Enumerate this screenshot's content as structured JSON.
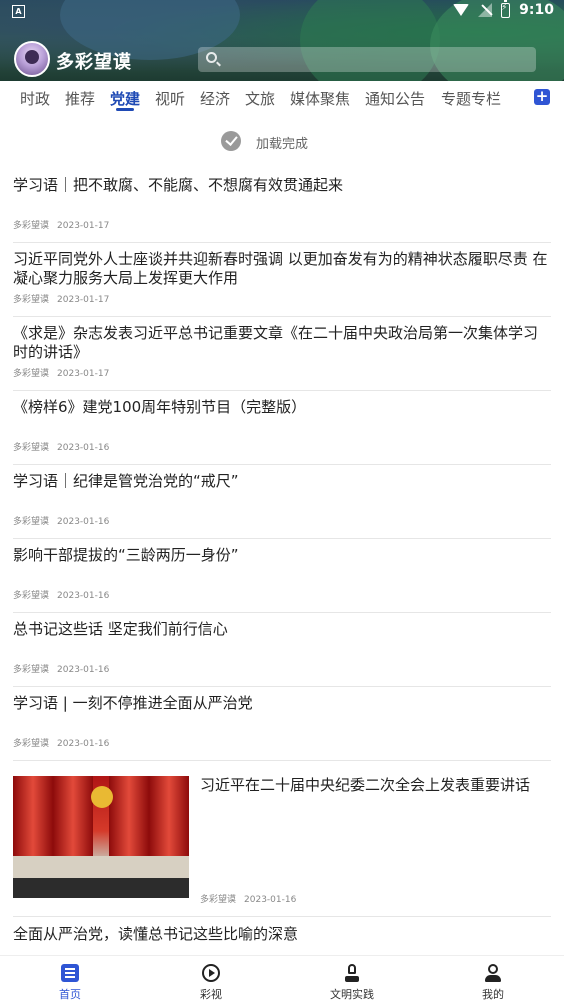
{
  "status_bar": {
    "time": "9:10"
  },
  "header": {
    "app_title": "多彩望谟",
    "search_placeholder": ""
  },
  "tabs": [
    {
      "label": "时政"
    },
    {
      "label": "推荐"
    },
    {
      "label": "党建",
      "active": true
    },
    {
      "label": "视听"
    },
    {
      "label": "经济"
    },
    {
      "label": "文旅"
    },
    {
      "label": "媒体聚焦"
    },
    {
      "label": "通知公告"
    },
    {
      "label": "专题专栏"
    }
  ],
  "loaded_text": "加载完成",
  "articles": [
    {
      "title": "学习语｜把不敢腐、不能腐、不想腐有效贯通起来",
      "source": "多彩望谟",
      "date": "2023-01-17"
    },
    {
      "title": "习近平同党外人士座谈并共迎新春时强调 以更加奋发有为的精神状态履职尽责 在凝心聚力服务大局上发挥更大作用",
      "source": "多彩望谟",
      "date": "2023-01-17"
    },
    {
      "title": "《求是》杂志发表习近平总书记重要文章《在二十届中央政治局第一次集体学习时的讲话》",
      "source": "多彩望谟",
      "date": "2023-01-17"
    },
    {
      "title": "《榜样6》建党100周年特别节目（完整版）",
      "source": "多彩望谟",
      "date": "2023-01-16"
    },
    {
      "title": "学习语｜纪律是管党治党的“戒尺”",
      "source": "多彩望谟",
      "date": "2023-01-16"
    },
    {
      "title": "影响干部提拔的“三龄两历一身份”",
      "source": "多彩望谟",
      "date": "2023-01-16"
    },
    {
      "title": "总书记这些话 坚定我们前行信心",
      "source": "多彩望谟",
      "date": "2023-01-16"
    },
    {
      "title": "学习语 | 一刻不停推进全面从严治党",
      "source": "多彩望谟",
      "date": "2023-01-16"
    },
    {
      "title": "习近平在二十届中央纪委二次全会上发表重要讲话",
      "source": "多彩望谟",
      "date": "2023-01-16"
    },
    {
      "title": "全面从严治党，读懂总书记这些比喻的深意"
    }
  ],
  "bottom_nav": [
    {
      "label": "首页",
      "icon": "home-icon",
      "active": true
    },
    {
      "label": "彩视",
      "icon": "video-play-icon"
    },
    {
      "label": "文明实践",
      "icon": "practice-icon"
    },
    {
      "label": "我的",
      "icon": "profile-icon"
    }
  ],
  "colors": {
    "accent": "#1f4ab5",
    "nav_active": "#2f55d4"
  }
}
